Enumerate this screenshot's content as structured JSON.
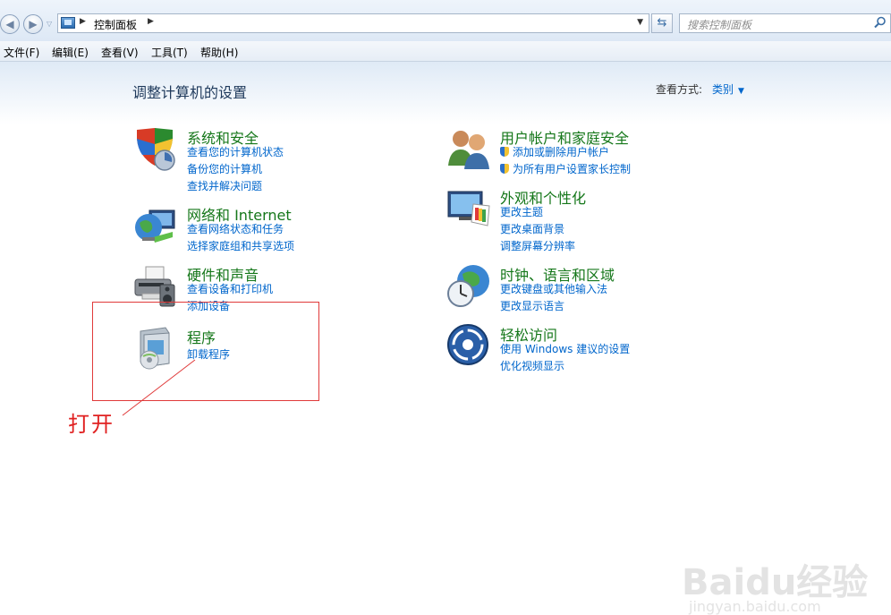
{
  "address": {
    "path_item": "控制面板",
    "search_placeholder": "搜索控制面板"
  },
  "menu": [
    "文件(F)",
    "编辑(E)",
    "查看(V)",
    "工具(T)",
    "帮助(H)"
  ],
  "page_title": "调整计算机的设置",
  "view": {
    "label": "查看方式:",
    "value": "类别"
  },
  "categories": [
    {
      "title": "系统和安全",
      "links": [
        "查看您的计算机状态",
        "备份您的计算机",
        "查找并解决问题"
      ]
    },
    {
      "title": "网络和 Internet",
      "links": [
        "查看网络状态和任务",
        "选择家庭组和共享选项"
      ]
    },
    {
      "title": "硬件和声音",
      "links": [
        "查看设备和打印机",
        "添加设备"
      ]
    },
    {
      "title": "程序",
      "links": [
        "卸载程序"
      ]
    },
    {
      "title": "用户帐户和家庭安全",
      "links": [
        "添加或删除用户帐户",
        "为所有用户设置家长控制"
      ]
    },
    {
      "title": "外观和个性化",
      "links": [
        "更改主题",
        "更改桌面背景",
        "调整屏幕分辨率"
      ]
    },
    {
      "title": "时钟、语言和区域",
      "links": [
        "更改键盘或其他输入法",
        "更改显示语言"
      ]
    },
    {
      "title": "轻松访问",
      "links": [
        "使用 Windows 建议的设置",
        "优化视频显示"
      ]
    }
  ],
  "annotation": "打开",
  "watermark": {
    "main": "Baidu经验",
    "sub": "jingyan.baidu.com"
  },
  "colors": {
    "title_green": "#15771a",
    "link_blue": "#0066cc",
    "annotation_red": "#e02020"
  }
}
